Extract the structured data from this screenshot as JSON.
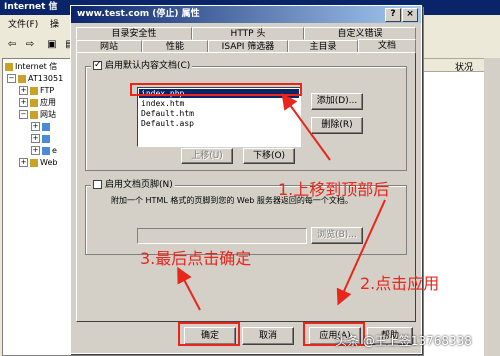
{
  "background_window": {
    "title": "Internet 信",
    "menu": [
      "文件(F)",
      "操"
    ],
    "tree": [
      {
        "label": "Internet 信",
        "depth": 0,
        "expander": ""
      },
      {
        "label": "AT13051",
        "depth": 1,
        "expander": "−"
      },
      {
        "label": "FTP",
        "depth": 2,
        "expander": "+"
      },
      {
        "label": "应用",
        "depth": 2,
        "expander": "+"
      },
      {
        "label": "网站",
        "depth": 2,
        "expander": "−"
      },
      {
        "label": "",
        "depth": 3,
        "expander": "+"
      },
      {
        "label": "",
        "depth": 3,
        "expander": "+"
      },
      {
        "label": "e",
        "depth": 3,
        "expander": "+"
      },
      {
        "label": "Web",
        "depth": 2,
        "expander": "+"
      }
    ],
    "right_column_header": "状况"
  },
  "dialog": {
    "title": "www.test.com (停止) 属性",
    "help_btn": "?",
    "close_btn": "×",
    "tabs_row1": [
      "目录安全性",
      "HTTP 头",
      "自定义错误"
    ],
    "tabs_row2": [
      "网站",
      "性能",
      "ISAPI 筛选器",
      "主目录",
      "文档"
    ],
    "active_tab": "文档",
    "default_doc": {
      "checkbox_label": "启用默认内容文档(C)",
      "checked": true,
      "items": [
        "index.php",
        "index.htm",
        "Default.htm",
        "Default.asp"
      ],
      "selected_index": 0,
      "add_button": "添加(D)...",
      "remove_button": "删除(R)",
      "move_up_button": "上移(U)",
      "move_down_button": "下移(O)"
    },
    "footer": {
      "checkbox_label": "启用文档页脚(N)",
      "checked": false,
      "description": "附加一个 HTML 格式的页脚到您的 Web 服务器返回的每一个文档。",
      "path_value": "",
      "browse_button": "浏览(B)..."
    },
    "buttons": {
      "ok": "确定",
      "cancel": "取消",
      "apply": "应用(A)",
      "help": "帮助"
    }
  },
  "annotations": {
    "step1": "1.上移到顶部后",
    "step2": "2.点击应用",
    "step3": "3.最后点击确定",
    "color": "#e8261c"
  },
  "watermark": "头条 @王上签13768338"
}
